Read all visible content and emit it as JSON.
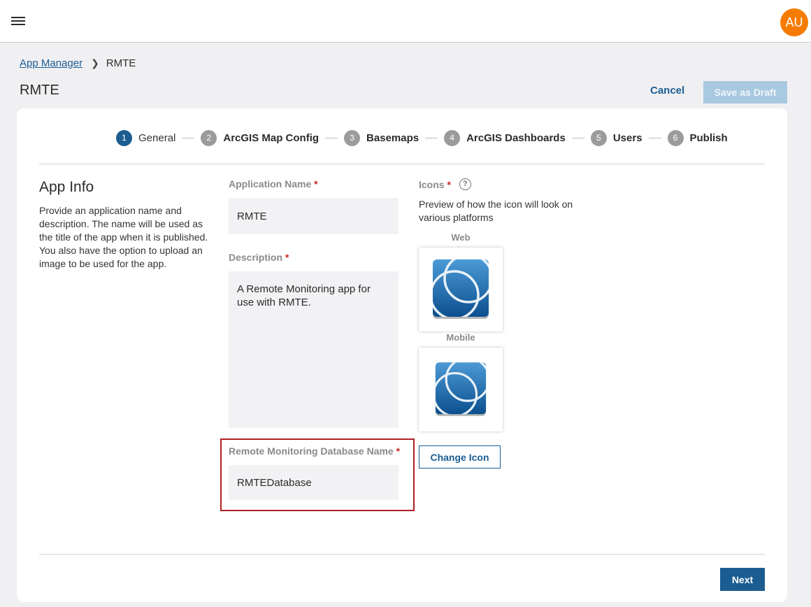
{
  "header": {
    "avatar_initials": "AU"
  },
  "breadcrumb": {
    "parent": "App Manager",
    "current": "RMTE"
  },
  "page": {
    "title": "RMTE"
  },
  "actions": {
    "cancel": "Cancel",
    "save_draft": "Save as Draft",
    "next": "Next"
  },
  "steps": [
    {
      "num": "1",
      "label": "General"
    },
    {
      "num": "2",
      "label": "ArcGIS Map Config"
    },
    {
      "num": "3",
      "label": "Basemaps"
    },
    {
      "num": "4",
      "label": "ArcGIS Dashboards"
    },
    {
      "num": "5",
      "label": "Users"
    },
    {
      "num": "6",
      "label": "Publish"
    }
  ],
  "app_info": {
    "title": "App Info",
    "description": "Provide an application name and description. The name will be used as the title of the app when it is published. You also have the option to upload an image to be used for the app."
  },
  "form": {
    "app_name": {
      "label": "Application Name",
      "value": "RMTE"
    },
    "description": {
      "label": "Description",
      "value": "A Remote Monitoring app for use with RMTE."
    },
    "db_name": {
      "label": "Remote Monitoring Database Name",
      "value": "RMTEDatabase"
    },
    "required_marker": "*"
  },
  "icons": {
    "label": "Icons",
    "help": "?",
    "description": "Preview of how the icon will look on various platforms",
    "web_label": "Web",
    "mobile_label": "Mobile",
    "change_button": "Change Icon"
  },
  "colors": {
    "primary": "#1b5d91",
    "avatar": "#f57c00",
    "required": "#c62828",
    "highlight": "#b01f24"
  }
}
